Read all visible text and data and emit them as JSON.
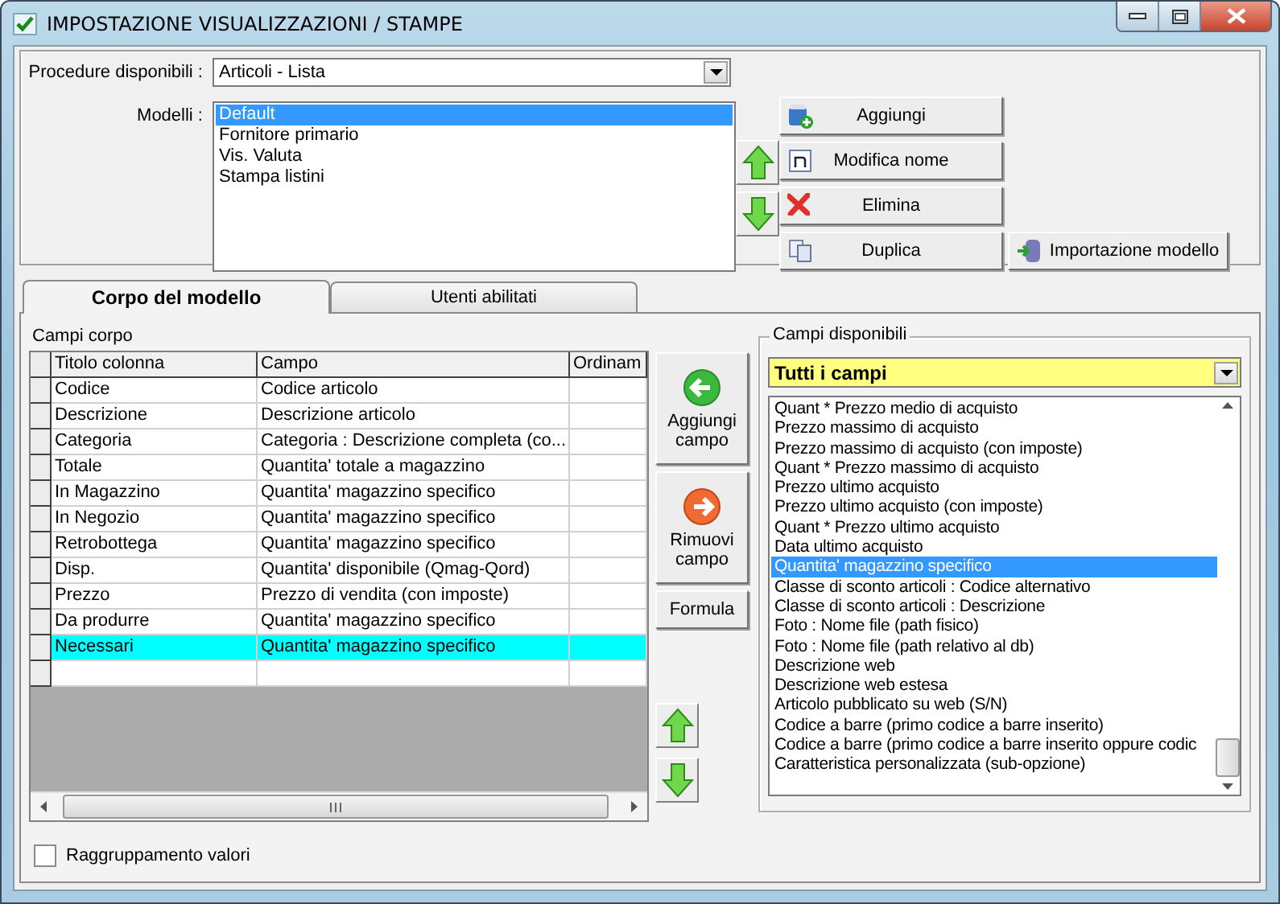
{
  "window": {
    "title": "IMPOSTAZIONE VISUALIZZAZIONI / STAMPE"
  },
  "procedure": {
    "label": "Procedure disponibili :",
    "value": "Articoli - Lista"
  },
  "models": {
    "label": "Modelli :",
    "items": [
      {
        "label": "Default",
        "selected": true
      },
      {
        "label": "Fornitore primario",
        "selected": false
      },
      {
        "label": "Vis. Valuta",
        "selected": false
      },
      {
        "label": "Stampa listini",
        "selected": false
      }
    ]
  },
  "model_buttons": [
    {
      "label": "Aggiungi",
      "kind": "add"
    },
    {
      "label": "Modifica nome",
      "kind": "rename"
    },
    {
      "label": "Elimina",
      "kind": "delete"
    },
    {
      "label": "Duplica",
      "kind": "copy"
    },
    {
      "label": "Importazione modello",
      "kind": "import"
    }
  ],
  "tabs": [
    {
      "label": "Corpo del modello",
      "selected": true
    },
    {
      "label": "Utenti abilitati",
      "selected": false
    }
  ],
  "body": {
    "label": "Campi corpo",
    "columns": [
      "Titolo colonna",
      "Campo",
      "Ordinam"
    ],
    "rows": [
      {
        "title": "Codice",
        "field": "Codice articolo",
        "selected": false
      },
      {
        "title": "Descrizione",
        "field": "Descrizione articolo",
        "selected": false
      },
      {
        "title": "Categoria",
        "field": "Categoria : Descrizione completa (co...",
        "selected": false
      },
      {
        "title": "Totale",
        "field": "Quantita' totale a magazzino",
        "selected": false
      },
      {
        "title": "In Magazzino",
        "field": "Quantita' magazzino specifico",
        "selected": false
      },
      {
        "title": "In Negozio",
        "field": "Quantita' magazzino specifico",
        "selected": false
      },
      {
        "title": "Retrobottega",
        "field": "Quantita' magazzino specifico",
        "selected": false
      },
      {
        "title": "Disp.",
        "field": "Quantita' disponibile (Qmag-Qord)",
        "selected": false
      },
      {
        "title": "Prezzo",
        "field": "Prezzo di vendita (con imposte)",
        "selected": false
      },
      {
        "title": "Da produrre",
        "field": "Quantita' magazzino specifico",
        "selected": false
      },
      {
        "title": "Necessari",
        "field": "Quantita' magazzino specifico",
        "selected": true
      }
    ]
  },
  "field_buttons": [
    {
      "label": "Aggiungi campo",
      "kind": "add"
    },
    {
      "label": "Rimuovi campo",
      "kind": "remove"
    },
    {
      "label": "Formula",
      "kind": "text"
    }
  ],
  "available": {
    "label": "Campi disponibili",
    "filter": "Tutti i campi",
    "items": [
      {
        "label": "Quant * Prezzo medio di acquisto",
        "selected": false
      },
      {
        "label": "Prezzo massimo di acquisto",
        "selected": false
      },
      {
        "label": "Prezzo massimo di acquisto (con imposte)",
        "selected": false
      },
      {
        "label": "Quant * Prezzo massimo di acquisto",
        "selected": false
      },
      {
        "label": "Prezzo ultimo acquisto",
        "selected": false
      },
      {
        "label": "Prezzo ultimo acquisto (con imposte)",
        "selected": false
      },
      {
        "label": "Quant * Prezzo ultimo acquisto",
        "selected": false
      },
      {
        "label": "Data ultimo acquisto",
        "selected": false
      },
      {
        "label": "Quantita' magazzino specifico",
        "selected": true
      },
      {
        "label": "Classe di sconto articoli : Codice alternativo",
        "selected": false
      },
      {
        "label": "Classe di sconto articoli : Descrizione",
        "selected": false
      },
      {
        "label": "Foto : Nome file (path fisico)",
        "selected": false
      },
      {
        "label": "Foto : Nome file (path relativo al db)",
        "selected": false
      },
      {
        "label": "Descrizione web",
        "selected": false
      },
      {
        "label": "Descrizione web estesa",
        "selected": false
      },
      {
        "label": "Articolo pubblicato su web (S/N)",
        "selected": false
      },
      {
        "label": "Codice a barre (primo codice a barre inserito)",
        "selected": false
      },
      {
        "label": "Codice a barre (primo codice a barre inserito oppure codic",
        "selected": false
      },
      {
        "label": "Caratteristica personalizzata (sub-opzione)",
        "selected": false
      }
    ]
  },
  "grouping": {
    "label": "Raggruppamento valori",
    "checked": false
  }
}
